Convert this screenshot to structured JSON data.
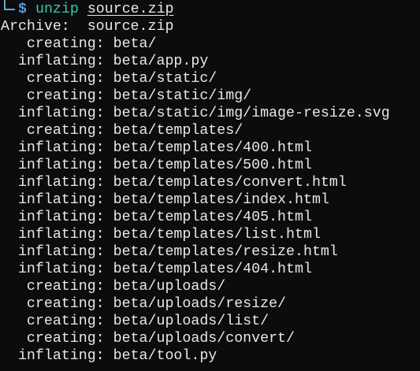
{
  "prompt": {
    "symbol": "$",
    "command": "unzip",
    "argument": "source.zip"
  },
  "output": [
    "Archive:  source.zip",
    "   creating: beta/",
    "  inflating: beta/app.py",
    "   creating: beta/static/",
    "   creating: beta/static/img/",
    "  inflating: beta/static/img/image-resize.svg",
    "   creating: beta/templates/",
    "  inflating: beta/templates/400.html",
    "  inflating: beta/templates/500.html",
    "  inflating: beta/templates/convert.html",
    "  inflating: beta/templates/index.html",
    "  inflating: beta/templates/405.html",
    "  inflating: beta/templates/list.html",
    "  inflating: beta/templates/resize.html",
    "  inflating: beta/templates/404.html",
    "   creating: beta/uploads/",
    "   creating: beta/uploads/resize/",
    "   creating: beta/uploads/list/",
    "   creating: beta/uploads/convert/",
    "  inflating: beta/tool.py"
  ],
  "colors": {
    "background": "#0c0c0f",
    "text": "#e8e8e8",
    "command": "#3ec6a8",
    "prompt_symbol": "#5b9bd5",
    "prompt_corner": "#6fa3c7"
  }
}
